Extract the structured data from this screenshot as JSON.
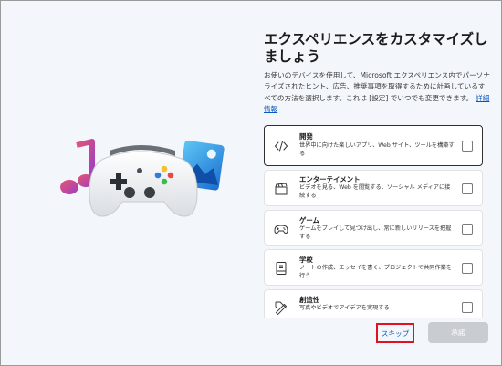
{
  "heading": "エクスペリエンスをカスタマイズしましょう",
  "description": {
    "text": "お使いのデバイスを使用して、Microsoft エクスペリエンス内でパーソナライズされたヒント、広告、推奨事項を取得するために計画しているすべての方法を選択します。これは [設定] でいつでも変更できます。",
    "link": "詳細情報"
  },
  "options": [
    {
      "title": "開発",
      "desc": "世界中に向けた楽しいアプリ、Web サイト、ツールを構築する",
      "icon": "code-icon",
      "selected": true
    },
    {
      "title": "エンターテイメント",
      "desc": "ビデオを見る、Web を閲覧する、ソーシャル メディアに接続する",
      "icon": "video-clapper-icon",
      "selected": false
    },
    {
      "title": "ゲーム",
      "desc": "ゲームをプレイして見つけ出し、常に新しいリリースを把握する",
      "icon": "gamepad-icon",
      "selected": false
    },
    {
      "title": "学校",
      "desc": "ノートの作成、エッセイを書く、プロジェクトで共同作業を行う",
      "icon": "notebook-icon",
      "selected": false
    },
    {
      "title": "創造性",
      "desc": "写真やビデオでアイデアを実現する",
      "icon": "pen-ruler-icon",
      "selected": false
    }
  ],
  "buttons": {
    "skip": "スキップ",
    "accept": "承諾"
  },
  "colors": {
    "link": "#0a57c2",
    "highlight": "#e0121f",
    "disabled_button": "#c9cdd2"
  }
}
